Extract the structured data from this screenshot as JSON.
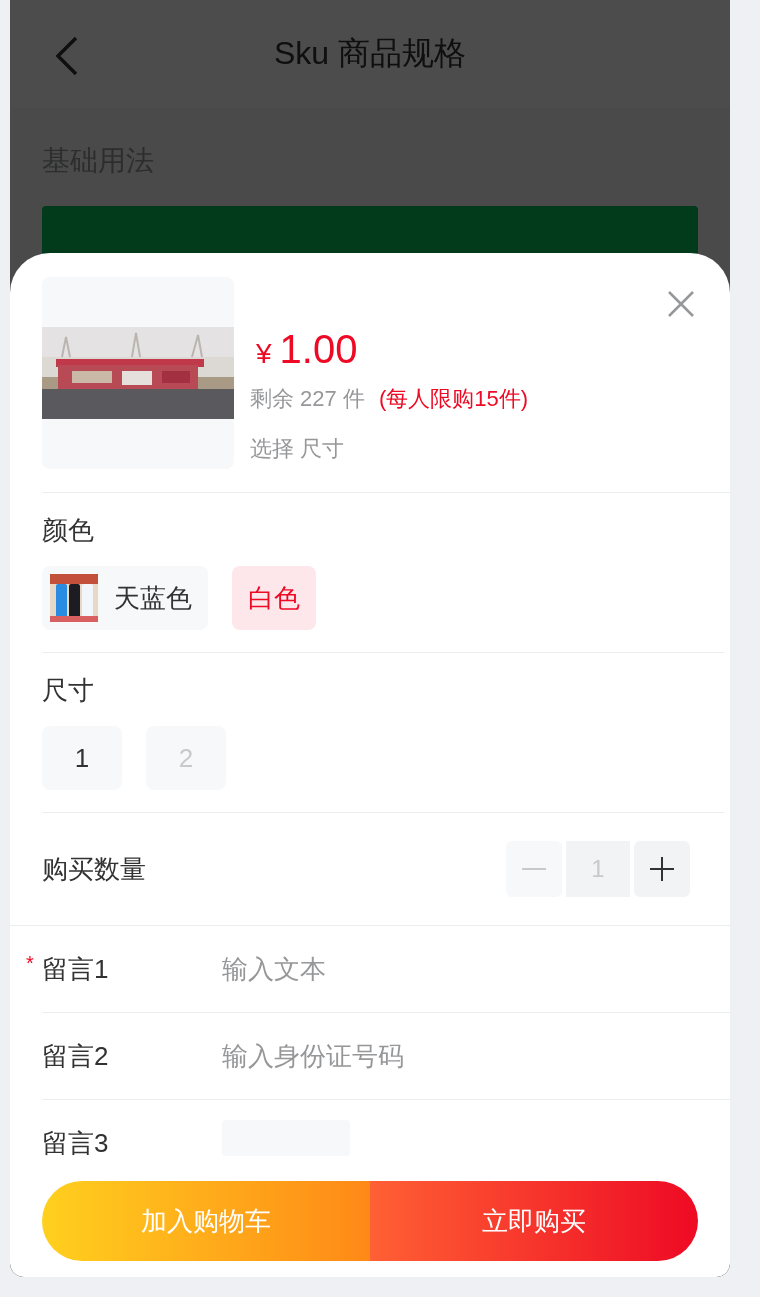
{
  "nav": {
    "title": "Sku 商品规格"
  },
  "section_title": "基础用法",
  "sku": {
    "price_symbol": "¥",
    "price": "1.00",
    "stock": "剩余 227 件",
    "quota": "(每人限购15件)",
    "selected_text": "选择 尺寸",
    "groups": [
      {
        "name": "颜色",
        "options": [
          {
            "label": "天蓝色",
            "selected": false,
            "disabled": false
          },
          {
            "label": "白色",
            "kind": "text",
            "selected": true,
            "disabled": false
          }
        ]
      },
      {
        "name": "尺寸",
        "options": [
          {
            "label": "1",
            "kind": "text",
            "selected": false,
            "disabled": false
          },
          {
            "label": "2",
            "kind": "text",
            "selected": false,
            "disabled": true
          }
        ]
      }
    ],
    "quantity": {
      "label": "购买数量",
      "value": "1",
      "minus_disabled": true,
      "plus_disabled": false
    },
    "messages": [
      {
        "label": "留言1",
        "required_mark": "*",
        "kind": "text",
        "placeholder": "输入文本"
      },
      {
        "label": "留言2",
        "kind": "text",
        "placeholder": "输入身份证号码"
      },
      {
        "label": "留言3",
        "kind": "upload"
      }
    ],
    "actions": [
      {
        "label": "加入购物车",
        "kind": "cart"
      },
      {
        "label": "立即购买",
        "kind": "buy"
      }
    ]
  }
}
